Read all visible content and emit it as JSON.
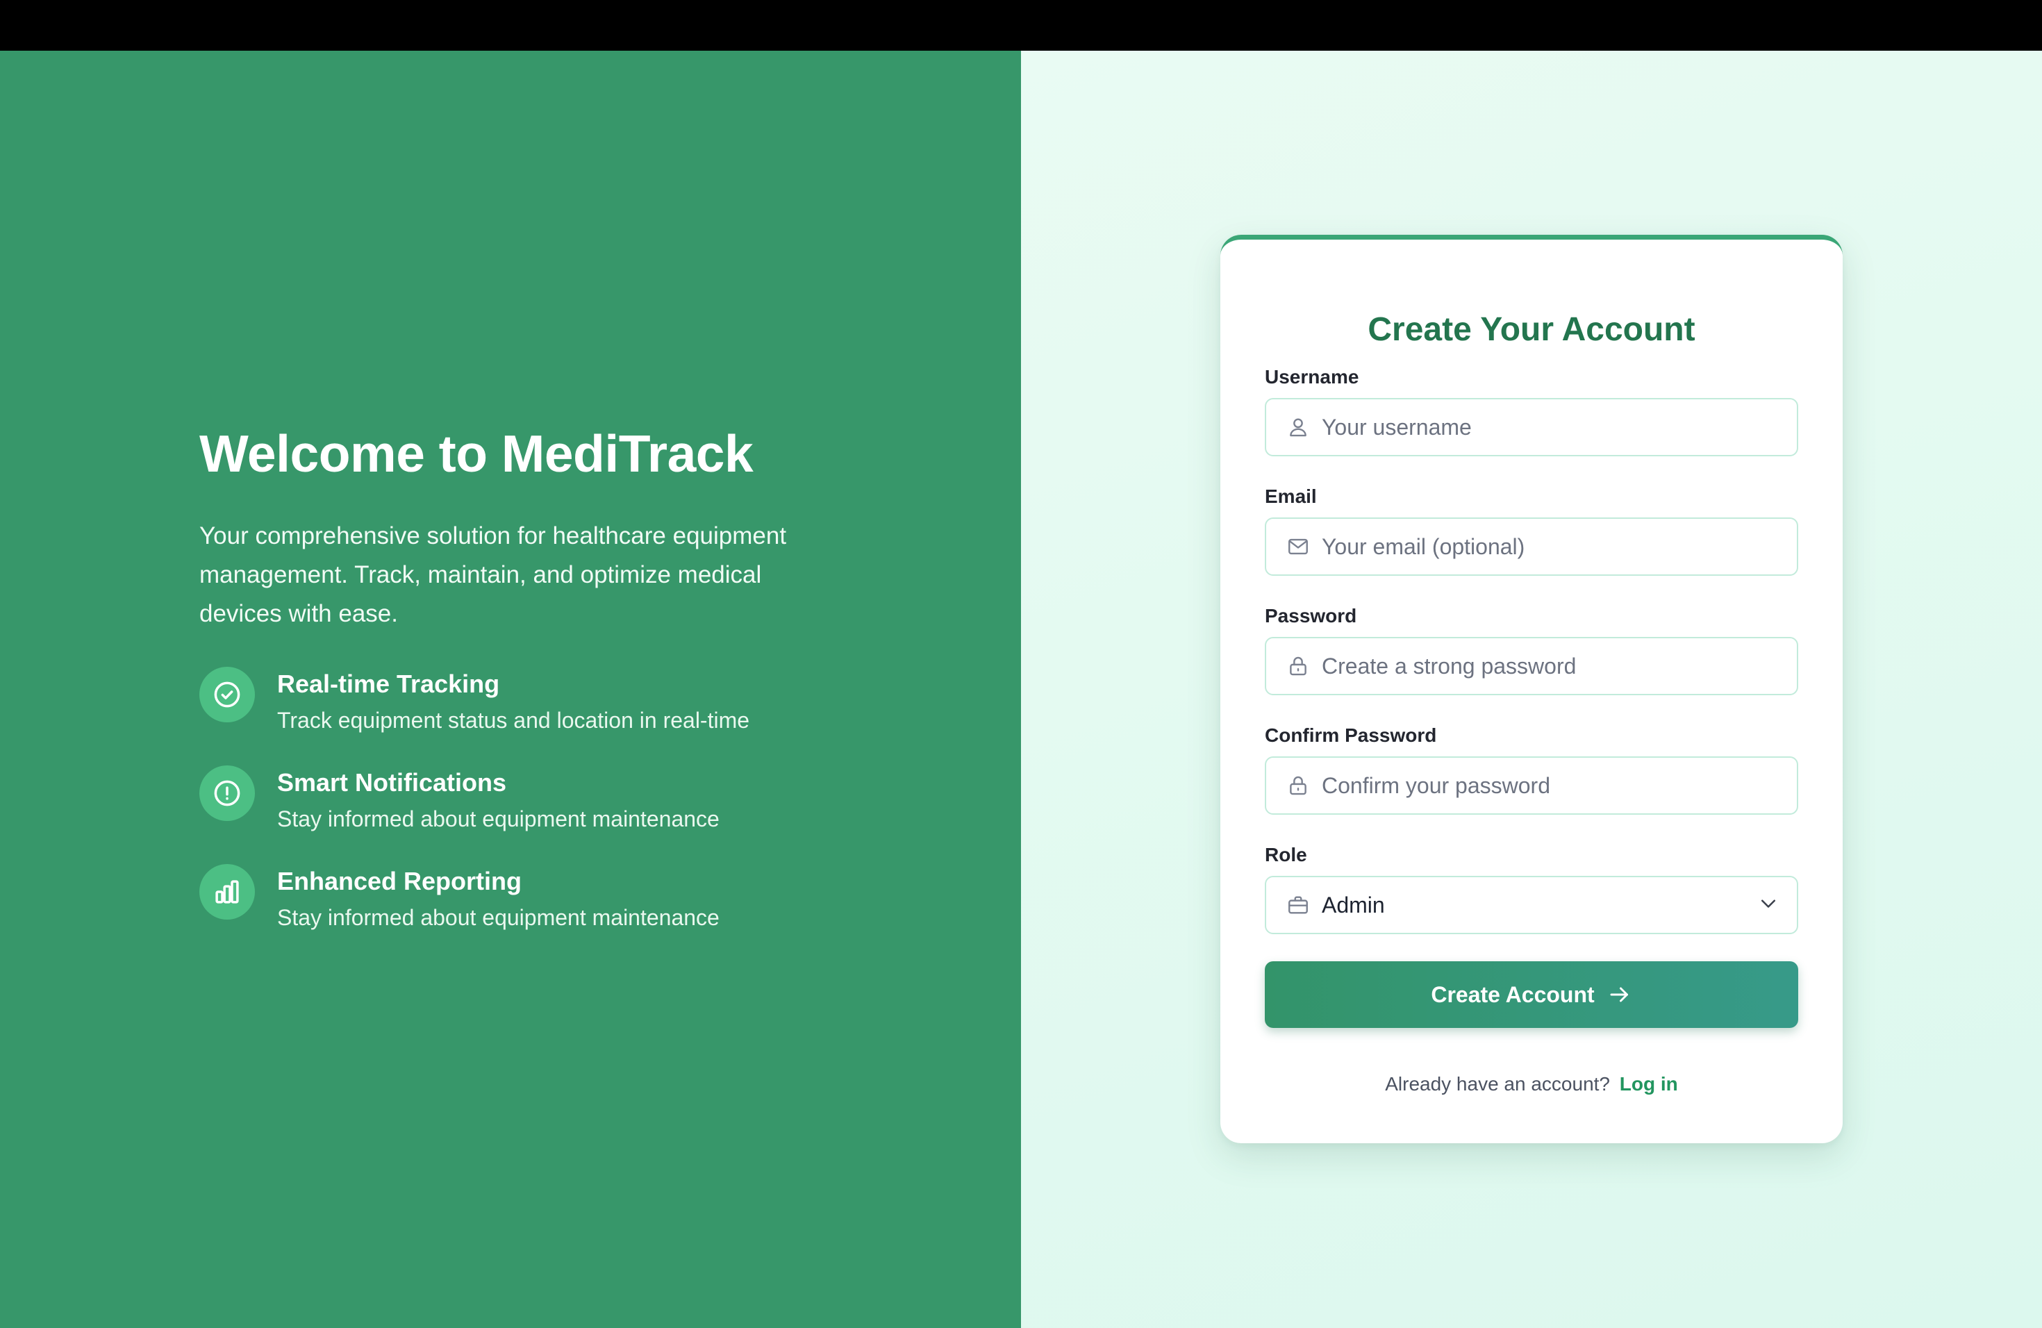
{
  "hero": {
    "title": "Welcome to MediTrack",
    "description": "Your comprehensive solution for healthcare equipment management. Track, maintain, and optimize medical devices with ease.",
    "features": [
      {
        "icon": "check-circle-icon",
        "title": "Real-time Tracking",
        "description": "Track equipment status and location in real-time"
      },
      {
        "icon": "alert-circle-icon",
        "title": "Smart Notifications",
        "description": "Stay informed about equipment maintenance"
      },
      {
        "icon": "bar-chart-icon",
        "title": "Enhanced Reporting",
        "description": "Stay informed about equipment maintenance"
      }
    ]
  },
  "form": {
    "title": "Create Your Account",
    "fields": {
      "username": {
        "label": "Username",
        "placeholder": "Your username",
        "value": "",
        "icon": "user-icon"
      },
      "email": {
        "label": "Email",
        "placeholder": "Your email (optional)",
        "value": "",
        "icon": "mail-icon"
      },
      "password": {
        "label": "Password",
        "placeholder": "Create a strong password",
        "value": "",
        "icon": "lock-icon"
      },
      "confirm_password": {
        "label": "Confirm Password",
        "placeholder": "Confirm your password",
        "value": "",
        "icon": "lock-icon"
      },
      "role": {
        "label": "Role",
        "selected": "Admin",
        "icon": "briefcase-icon"
      }
    },
    "submit_label": "Create Account",
    "login_prompt": "Already have an account?",
    "login_link": "Log in"
  },
  "colors": {
    "brand_green": "#37976a",
    "accent_light": "#4cbf84",
    "title_green": "#23754e",
    "link_green": "#22955f",
    "input_border": "#c2ebdb",
    "right_bg": "#e3faf1"
  }
}
